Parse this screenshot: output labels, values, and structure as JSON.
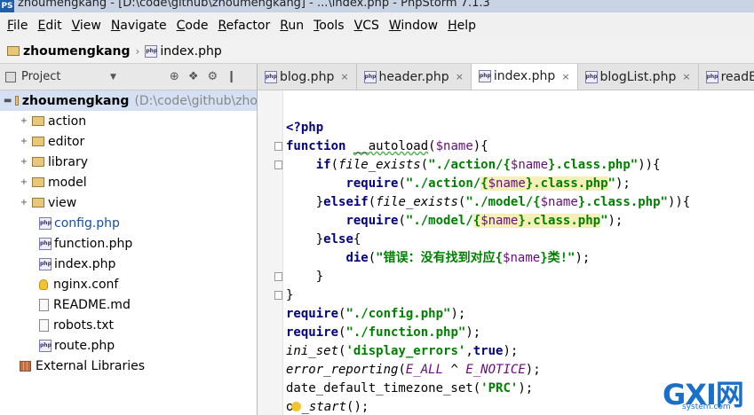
{
  "window": {
    "app_icon": "PS",
    "title": "zhoumengkang - [D:\\code\\github\\zhoumengkang] - ...\\index.php - PhpStorm 7.1.3"
  },
  "menu": [
    "File",
    "Edit",
    "View",
    "Navigate",
    "Code",
    "Refactor",
    "Run",
    "Tools",
    "VCS",
    "Window",
    "Help"
  ],
  "breadcrumb": {
    "project": "zhoumengkang",
    "separator": "›",
    "file": "index.php"
  },
  "project_panel": {
    "label": "Project",
    "tools": [
      "⊕",
      "❖",
      "⚙",
      "❙"
    ],
    "root": {
      "name": "zhoumengkang",
      "path": "(D:\\code\\github\\zho"
    },
    "folders": [
      "action",
      "editor",
      "library",
      "model",
      "view"
    ],
    "files": [
      {
        "name": "config.php",
        "icon": "php-file-icon"
      },
      {
        "name": "function.php",
        "icon": "php-file-icon"
      },
      {
        "name": "index.php",
        "icon": "php-file-icon"
      },
      {
        "name": "nginx.conf",
        "icon": "config-file-icon"
      },
      {
        "name": "README.md",
        "icon": "text-file-icon"
      },
      {
        "name": "robots.txt",
        "icon": "text-file-icon"
      },
      {
        "name": "route.php",
        "icon": "php-file-icon"
      }
    ],
    "external": "External Libraries"
  },
  "tabs": [
    {
      "label": "blog.php",
      "close": "×"
    },
    {
      "label": "header.php",
      "close": "×"
    },
    {
      "label": "index.php",
      "close": "×"
    },
    {
      "label": "blogList.php",
      "close": "×"
    },
    {
      "label": "readB",
      "close": ""
    }
  ],
  "watermark": {
    "big": "GXI网",
    "small": "system.com"
  },
  "colors": {
    "keyword": "#000080",
    "string": "#008000",
    "variable": "#660e7a",
    "highlight": "#f6f0b8",
    "selection": "#d5e1f2"
  }
}
